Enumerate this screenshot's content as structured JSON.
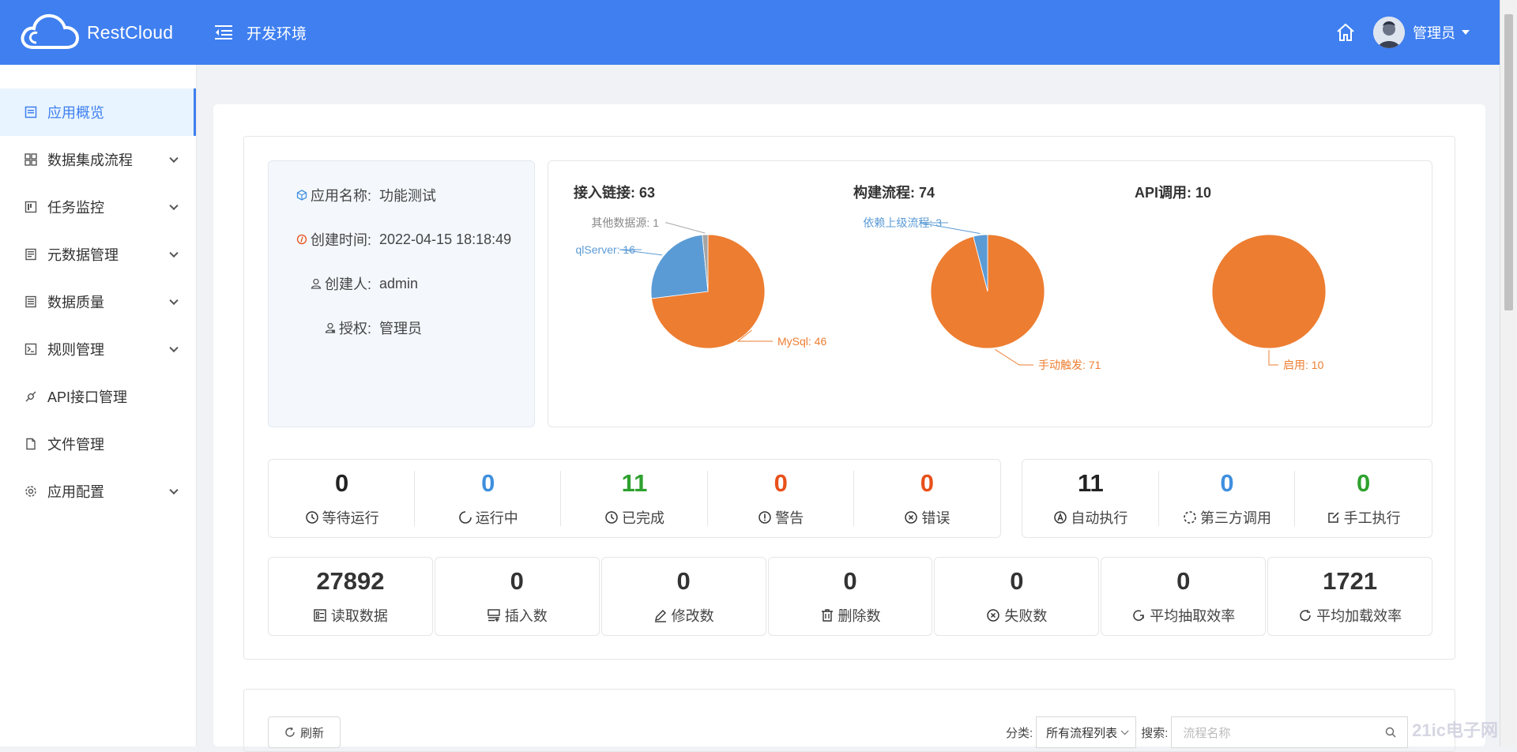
{
  "header": {
    "brand": "RestCloud",
    "environment": "开发环境",
    "user_name": "管理员",
    "icons": [
      "menu-toggle-icon",
      "home-icon",
      "avatar",
      "chevron-down-icon"
    ]
  },
  "sidebar": {
    "items": [
      {
        "label": "应用概览",
        "icon": "overview-icon",
        "active": true,
        "expandable": false
      },
      {
        "label": "数据集成流程",
        "icon": "grid-icon",
        "expandable": true
      },
      {
        "label": "任务监控",
        "icon": "monitor-icon",
        "expandable": true
      },
      {
        "label": "元数据管理",
        "icon": "metadata-icon",
        "expandable": true
      },
      {
        "label": "数据质量",
        "icon": "quality-icon",
        "expandable": true
      },
      {
        "label": "规则管理",
        "icon": "terminal-icon",
        "expandable": true
      },
      {
        "label": "API接口管理",
        "icon": "api-icon",
        "expandable": false
      },
      {
        "label": "文件管理",
        "icon": "file-icon",
        "expandable": false
      },
      {
        "label": "应用配置",
        "icon": "gear-icon",
        "expandable": true
      }
    ]
  },
  "app_info": {
    "name_label": "应用名称:",
    "name_value": "功能测试",
    "created_label": "创建时间:",
    "created_value": "2022-04-15 18:18:49",
    "creator_label": "创建人:",
    "creator_value": "admin",
    "auth_label": "授权:",
    "auth_value": "管理员"
  },
  "chart_data": [
    {
      "type": "pie",
      "title": "接入链接: 63",
      "slices": [
        {
          "label": "MySql",
          "value": 46,
          "color": "#ed7d31"
        },
        {
          "label": "qlServer",
          "value": 16,
          "color": "#5b9bd5"
        },
        {
          "label": "其他数据源",
          "value": 1,
          "color": "#a5a5a5"
        }
      ],
      "slice_labels": [
        "MySql: 46",
        "qlServer: 16",
        "其他数据源: 1"
      ]
    },
    {
      "type": "pie",
      "title": "构建流程: 74",
      "slices": [
        {
          "label": "手动触发",
          "value": 71,
          "color": "#ed7d31"
        },
        {
          "label": "依赖上级流程",
          "value": 3,
          "color": "#5b9bd5"
        }
      ],
      "slice_labels": [
        "手动触发: 71",
        "依赖上级流程: 3"
      ]
    },
    {
      "type": "pie",
      "title": "API调用: 10",
      "slices": [
        {
          "label": "启用",
          "value": 10,
          "color": "#ed7d31"
        }
      ],
      "slice_labels": [
        "启用: 10"
      ]
    }
  ],
  "status_stats": [
    {
      "value": "0",
      "label": "等待运行",
      "color": "#222222",
      "icon": "clock-icon"
    },
    {
      "value": "0",
      "label": "运行中",
      "color": "#3f8fde",
      "icon": "loading-icon"
    },
    {
      "value": "11",
      "label": "已完成",
      "color": "#2ea12e",
      "icon": "clock-check-icon"
    },
    {
      "value": "0",
      "label": "警告",
      "color": "#e8501a",
      "icon": "warning-icon"
    },
    {
      "value": "0",
      "label": "错误",
      "color": "#e8501a",
      "icon": "error-icon"
    }
  ],
  "exec_stats": [
    {
      "value": "11",
      "label": "自动执行",
      "color": "#222222",
      "icon": "auto-icon"
    },
    {
      "value": "0",
      "label": "第三方调用",
      "color": "#3f8fde",
      "icon": "dashed-circle-icon"
    },
    {
      "value": "0",
      "label": "手工执行",
      "color": "#2ea12e",
      "icon": "edit-icon"
    }
  ],
  "data_stats": [
    {
      "value": "27892",
      "label": "读取数据",
      "icon": "read-icon"
    },
    {
      "value": "0",
      "label": "插入数",
      "icon": "insert-icon"
    },
    {
      "value": "0",
      "label": "修改数",
      "icon": "modify-icon"
    },
    {
      "value": "0",
      "label": "删除数",
      "icon": "delete-icon"
    },
    {
      "value": "0",
      "label": "失败数",
      "icon": "fail-icon"
    },
    {
      "value": "0",
      "label": "平均抽取效率",
      "icon": "refresh-icon"
    },
    {
      "value": "1721",
      "label": "平均加载效率",
      "icon": "refresh-icon"
    }
  ],
  "toolbar": {
    "refresh_label": "刷新",
    "category_label": "分类:",
    "category_value": "所有流程列表",
    "search_label": "搜索:",
    "search_placeholder": "流程名称"
  },
  "watermark": "21ic电子网"
}
